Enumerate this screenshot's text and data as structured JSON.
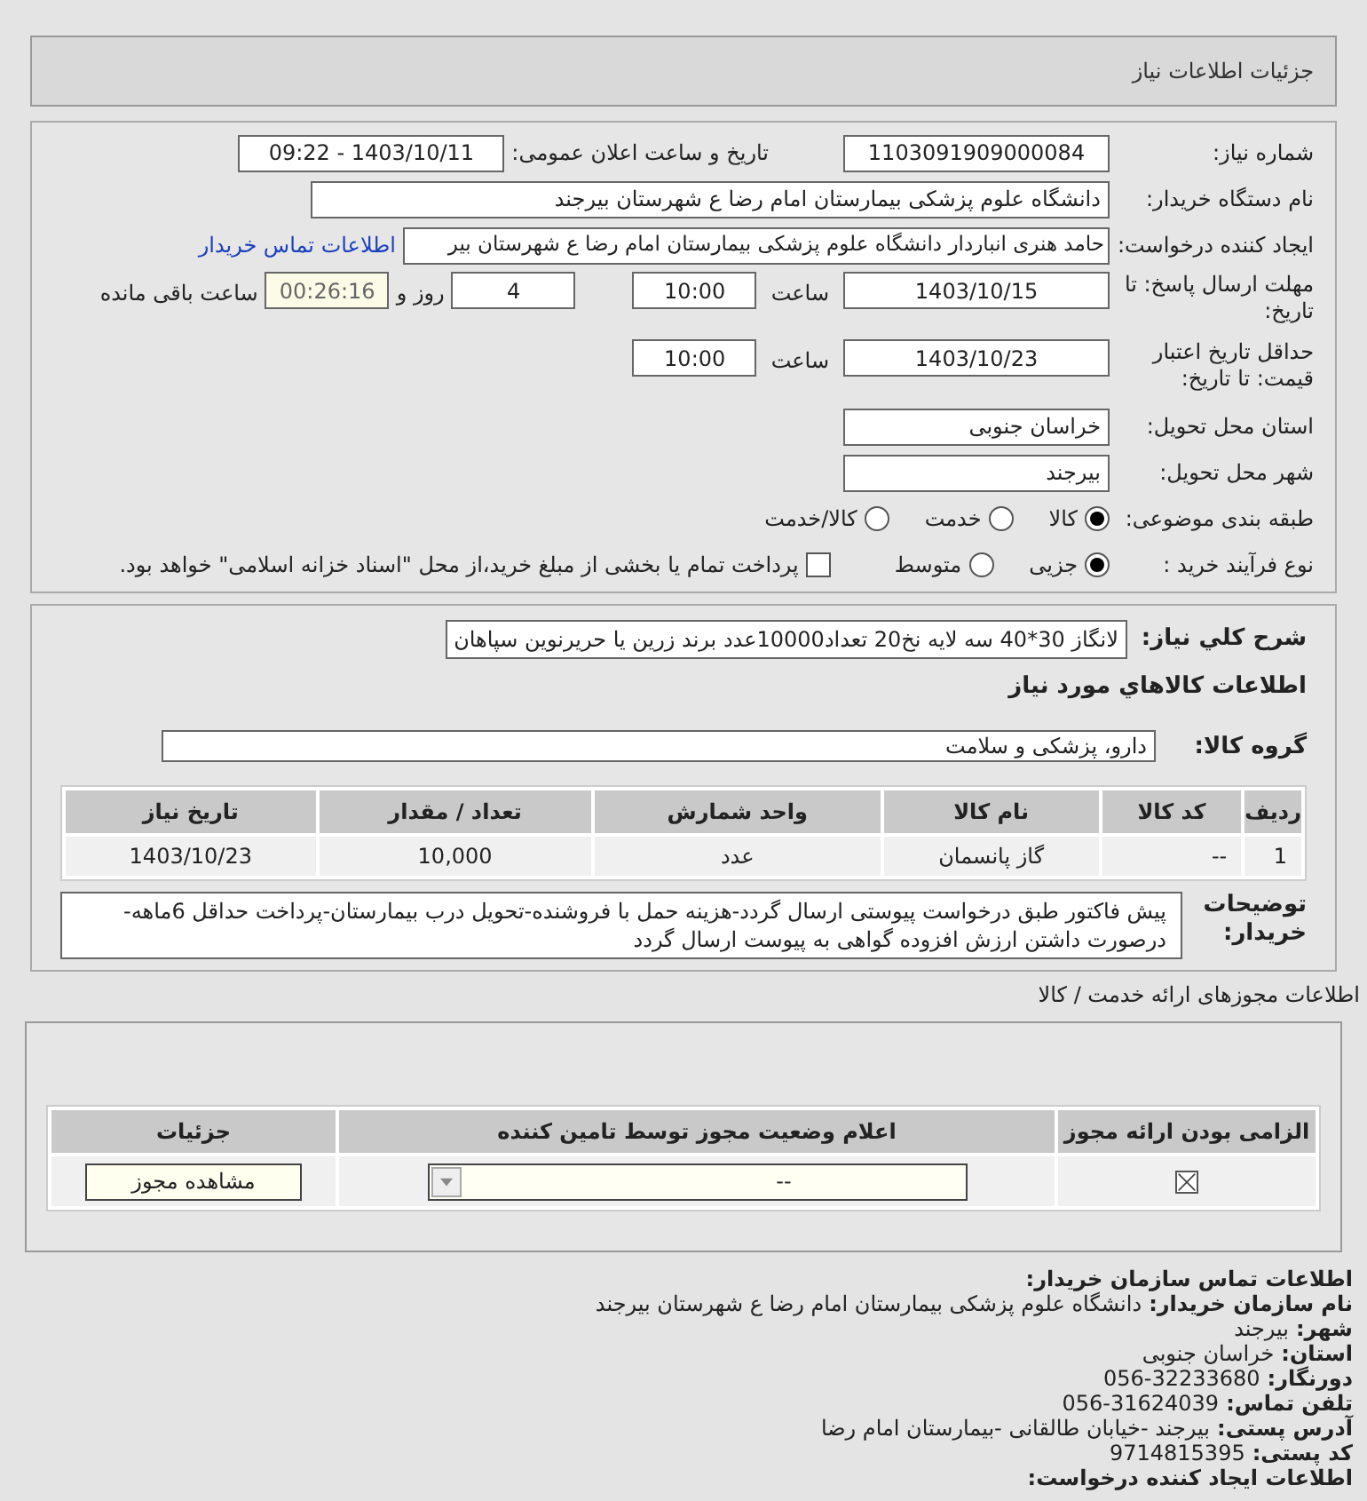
{
  "header": {
    "title": "جزئیات اطلاعات نیاز"
  },
  "form": {
    "need_number": {
      "label": "شماره نیاز:",
      "value": "1103091909000084"
    },
    "announce": {
      "label": "تاریخ و ساعت اعلان عمومی:",
      "value": "1403/10/11 - 09:22"
    },
    "buyer_org": {
      "label": "نام دستگاه خریدار:",
      "value": "دانشگاه علوم پزشکی  بیمارستان امام رضا ع  شهرستان بیرجند"
    },
    "requester": {
      "label": "ایجاد کننده درخواست:",
      "value": "حامد هنری انباردار دانشگاه علوم پزشکی  بیمارستان امام رضا ع  شهرستان بیر",
      "link": "اطلاعات تماس خریدار"
    },
    "deadline": {
      "label": "مهلت ارسال پاسخ: تا تاریخ:",
      "date": "1403/10/15",
      "time_label": "ساعت",
      "time": "10:00",
      "days": "4",
      "days_label": "روز و",
      "remaining": "00:26:16",
      "remaining_label": "ساعت باقی مانده"
    },
    "validity": {
      "label": "حداقل تاریخ اعتبار قیمت: تا تاریخ:",
      "date": "1403/10/23",
      "time_label": "ساعت",
      "time": "10:00"
    },
    "province": {
      "label": "استان محل تحویل:",
      "value": "خراسان جنوبی"
    },
    "city": {
      "label": "شهر محل تحویل:",
      "value": "بیرجند"
    },
    "category": {
      "label": "طبقه بندی موضوعی:",
      "options": [
        {
          "label": "کالا",
          "selected": true
        },
        {
          "label": "خدمت",
          "selected": false
        },
        {
          "label": "کالا/خدمت",
          "selected": false
        }
      ]
    },
    "purchase_type": {
      "label": "نوع فرآیند خرید :",
      "options": [
        {
          "label": "جزیی",
          "selected": true
        },
        {
          "label": "متوسط",
          "selected": false
        }
      ],
      "payment": {
        "label": "پرداخت تمام یا بخشی از مبلغ خرید،از محل \"اسناد خزانه اسلامی\" خواهد بود.",
        "checked": false
      }
    }
  },
  "details": {
    "summary": {
      "label": "شرح كلي نياز:",
      "value": "لانگاز 30*40 سه لایه نخ20 تعداد10000عدد برند زرین یا حریرنوین سپاهان"
    },
    "items_heading": "اطلاعات كالاهاي مورد نياز",
    "group": {
      "label": "گروه کالا:",
      "value": "دارو، پزشکی و سلامت"
    },
    "table": {
      "columns": [
        "ردیف",
        "کد کالا",
        "نام کالا",
        "واحد شمارش",
        "تعداد / مقدار",
        "تاریخ نیاز"
      ],
      "rows": [
        [
          "1",
          "--",
          "گاز پانسمان",
          "عدد",
          "10,000",
          "1403/10/23"
        ]
      ]
    },
    "notes": {
      "label": "توضیحات خریدار:",
      "value": "پیش فاکتور طبق درخواست پیوستی ارسال گردد-هزینه حمل با فروشنده-تحویل درب بیمارستان-پرداخت حداقل 6ماهه-درصورت داشتن ارزش افزوده گواهی به پیوست ارسال گردد"
    }
  },
  "licenses": {
    "heading": "اطلاعات مجوزهای ارائه خدمت / کالا",
    "columns": [
      "الزامی بودن ارائه مجوز",
      "اعلام وضعیت مجوز توسط تامین کننده",
      "جزئیات"
    ],
    "rows": [
      {
        "required": true,
        "status": "--",
        "button": "مشاهده مجوز"
      }
    ]
  },
  "contact": {
    "title": "اطلاعات تماس سازمان خریدار:",
    "lines": [
      {
        "label": "نام سازمان خریدار:",
        "value": "دانشگاه علوم پزشکی بیمارستان امام رضا ع شهرستان بیرجند"
      },
      {
        "label": "شهر:",
        "value": "بیرجند"
      },
      {
        "label": "استان:",
        "value": "خراسان جنوبی"
      },
      {
        "label": "دورنگار:",
        "value": "056-32233680"
      },
      {
        "label": "تلفن تماس:",
        "value": "056-31624039"
      },
      {
        "label": "آدرس پستی:",
        "value": "بیرجند -خیابان طالقانی -بیمارستان امام رضا"
      },
      {
        "label": "کد پستی:",
        "value": "9714815395"
      }
    ],
    "next_title": "اطلاعات ایجاد کننده درخواست:"
  }
}
